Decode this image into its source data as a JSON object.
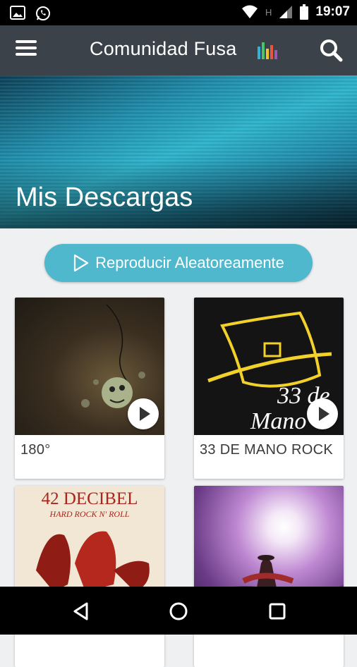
{
  "status_bar": {
    "time": "19:07",
    "network": "H"
  },
  "app_bar": {
    "title": "Comunidad Fusa"
  },
  "hero": {
    "title": "Mis Descargas"
  },
  "shuffle": {
    "label": "Reproducir Aleatoreamente"
  },
  "albums": [
    {
      "title": "180°"
    },
    {
      "title": "33 DE MANO ROCK"
    },
    {
      "title": "",
      "cover_text": "42 DECIBEL",
      "cover_subtext": "HARD ROCK N' ROLL"
    },
    {
      "title": ""
    }
  ],
  "cover_art": {
    "mano_line1": "33 de",
    "mano_line2": "Mano"
  },
  "colors": {
    "accent": "#4fb8cc",
    "app_bar": "#3b4249",
    "background": "#eef0f2"
  }
}
